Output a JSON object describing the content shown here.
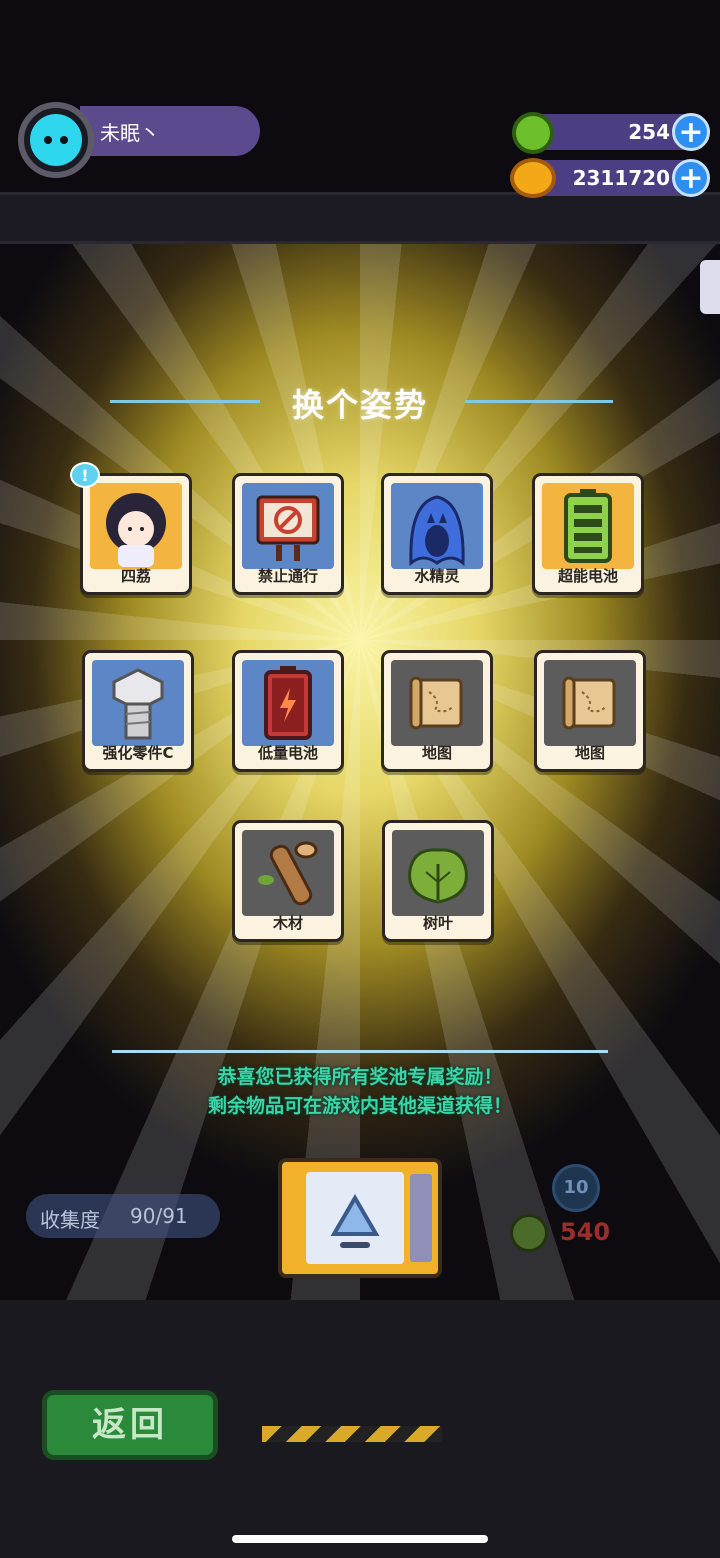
{
  "player": {
    "name": "未眠丶"
  },
  "currencies": [
    {
      "icon": "green-coin-icon",
      "value": "254"
    },
    {
      "icon": "gold-planet-coin-icon",
      "value": "2311720"
    }
  ],
  "plus_label": "+",
  "title": "换个姿势",
  "badge": "!",
  "items": [
    {
      "label": "四荔",
      "icon": "character-portrait-icon",
      "bg": "gold"
    },
    {
      "label": "禁止通行",
      "icon": "no-entry-sign-icon",
      "bg": "blue"
    },
    {
      "label": "水精灵",
      "icon": "water-spirit-icon",
      "bg": "blue"
    },
    {
      "label": "超能电池",
      "icon": "full-battery-icon",
      "bg": "gold"
    },
    {
      "label": "强化零件C",
      "icon": "bolt-icon",
      "bg": "blue"
    },
    {
      "label": "低量电池",
      "icon": "low-battery-icon",
      "bg": "blue"
    },
    {
      "label": "地图",
      "icon": "map-scroll-icon",
      "bg": "gray"
    },
    {
      "label": "地图",
      "icon": "map-scroll-icon",
      "bg": "gray"
    },
    {
      "label": "木材",
      "icon": "wood-log-icon",
      "bg": "gray"
    },
    {
      "label": "树叶",
      "icon": "leaf-icon",
      "bg": "gray"
    }
  ],
  "message": {
    "line1": "恭喜您已获得所有奖池专属奖励！",
    "line2": "剩余物品可在游戏内其他渠道获得！"
  },
  "collection": {
    "label": "收集度",
    "value": "90/91"
  },
  "draw": {
    "cost": "540",
    "level": "10"
  },
  "back_label": "返回",
  "colors": {
    "accent_blue": "#2f8ff0",
    "message_green": "#3ad6a7",
    "pill_purple": "#4b3e83"
  }
}
